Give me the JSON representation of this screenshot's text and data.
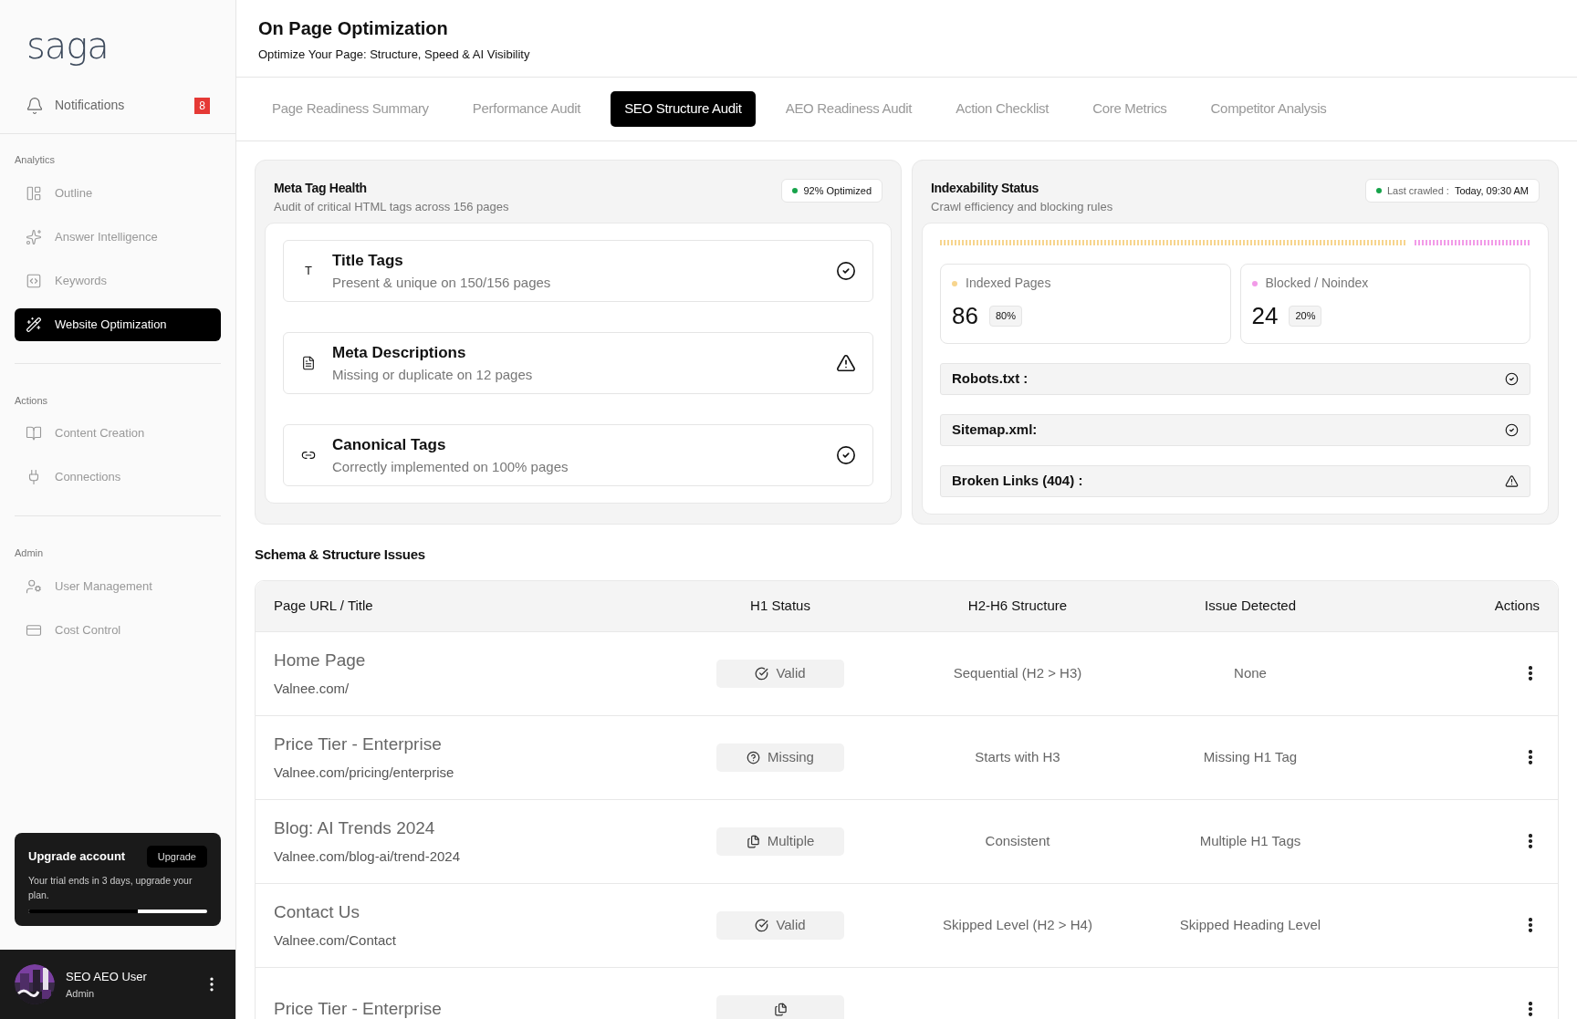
{
  "sidebar": {
    "logo": "saga",
    "notifications": {
      "label": "Notifications",
      "count": "8"
    },
    "sections": [
      {
        "title": "Analytics",
        "items": [
          {
            "label": "Outline",
            "selected": false
          },
          {
            "label": "Answer Intelligence",
            "selected": false
          },
          {
            "label": "Keywords",
            "selected": false
          },
          {
            "label": "Website Optimization",
            "selected": true
          }
        ]
      },
      {
        "title": "Actions",
        "items": [
          {
            "label": "Content Creation",
            "selected": false
          },
          {
            "label": "Connections",
            "selected": false
          }
        ]
      },
      {
        "title": "Admin",
        "items": [
          {
            "label": "User Management",
            "selected": false
          },
          {
            "label": "Cost Control",
            "selected": false
          }
        ]
      }
    ],
    "upgrade": {
      "title": "Upgrade account",
      "button": "Upgrade",
      "text": "Your trial ends in 3 days, upgrade your plan.",
      "level": 0.61
    },
    "user": {
      "name": "SEO AEO User",
      "role": "Admin"
    }
  },
  "header": {
    "title": "On Page Optimization",
    "subtitle": "Optimize Your Page: Structure, Speed & AI Visibility"
  },
  "tabs": [
    {
      "label": "Page Readiness Summary",
      "selected": false
    },
    {
      "label": "Performance Audit",
      "selected": false
    },
    {
      "label": "SEO Structure Audit",
      "selected": true
    },
    {
      "label": "AEO Readiness Audit",
      "selected": false
    },
    {
      "label": "Action Checklist",
      "selected": false
    },
    {
      "label": "Core Metrics",
      "selected": false
    },
    {
      "label": "Competitor Analysis",
      "selected": false
    }
  ],
  "meta_tag_health": {
    "title": "Meta Tag Health",
    "subtitle": "Audit of critical HTML tags across 156 pages",
    "badge": "92% Optimized",
    "items": [
      {
        "icon": "T",
        "title": "Title Tags",
        "detail": "Present & unique on 150/156 pages",
        "kind": "ok"
      },
      {
        "title": "Meta Descriptions",
        "detail": "Missing or duplicate on 12 pages",
        "kind": "warning"
      },
      {
        "title": "Canonical Tags",
        "detail": "Correctly implemented on 100% pages",
        "kind": "ok"
      }
    ]
  },
  "indexability": {
    "title": "Indexability Status",
    "subtitle": "Crawl efficiency and blocking rules",
    "crawl_label": "Last crawled :",
    "crawl_time": "Today, 09:30 AM",
    "stats": [
      {
        "label": "Indexed Pages",
        "value": "86",
        "percent": "80%",
        "level": 0.8,
        "color": "#f7d58e"
      },
      {
        "label": "Blocked / Noindex",
        "value": "24",
        "percent": "20%",
        "color": "#f29be8"
      }
    ],
    "checks": [
      {
        "label": "Robots.txt :",
        "kind": "ok"
      },
      {
        "label": "Sitemap.xml:",
        "kind": "ok"
      },
      {
        "label": "Broken Links (404) :",
        "kind": "warning"
      }
    ]
  },
  "schema": {
    "title": "Schema & Structure Issues",
    "columns": [
      "Page URL / Title",
      "H1 Status",
      "H2-H6 Structure",
      "Issue Detected",
      "Actions"
    ],
    "rows": [
      {
        "title": "Home Page",
        "url": "Valnee.com/",
        "h1": "Valid",
        "kind": "valid",
        "structure": "Sequential (H2 > H3)",
        "issue": "None"
      },
      {
        "title": "Price Tier - Enterprise",
        "url": "Valnee.com/pricing/enterprise",
        "h1": "Missing",
        "kind": "missing",
        "structure": "Starts with H3",
        "issue": "Missing H1 Tag"
      },
      {
        "title": "Blog: AI Trends 2024",
        "url": "Valnee.com/blog-ai/trend-2024",
        "h1": "Multiple",
        "kind": "multiple",
        "structure": "Consistent",
        "issue": "Multiple H1 Tags"
      },
      {
        "title": "Contact Us",
        "url": "Valnee.com/Contact",
        "h1": "Valid",
        "kind": "valid",
        "structure": "Skipped Level (H2 > H4)",
        "issue": "Skipped Heading Level"
      },
      {
        "title": "Price Tier - Enterprise",
        "kind": "multiple"
      }
    ]
  }
}
